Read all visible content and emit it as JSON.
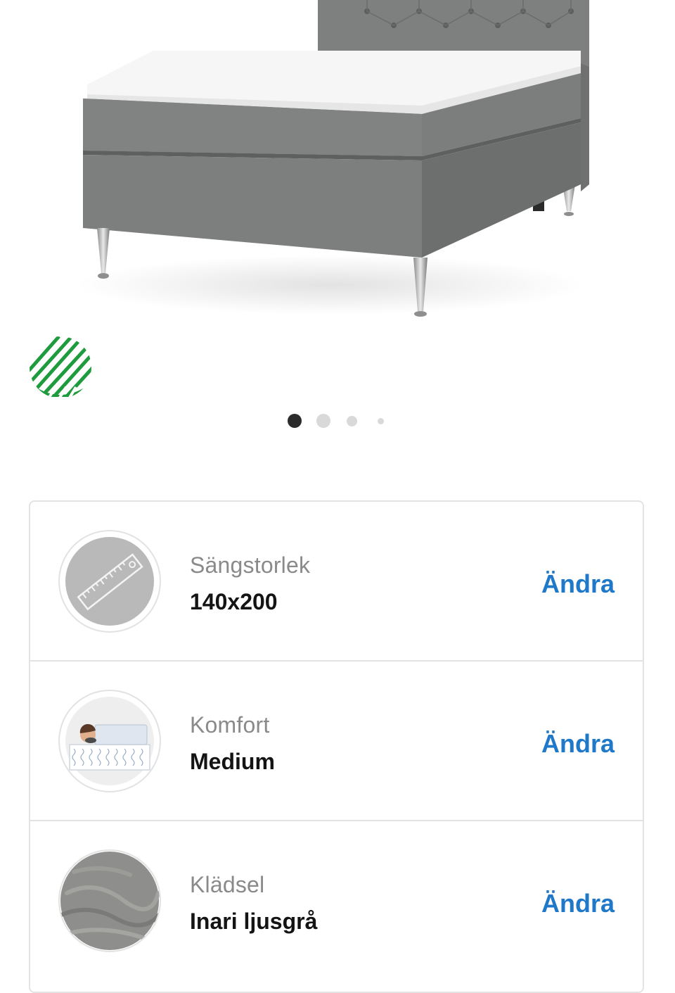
{
  "gallery": {
    "image_alt": "Continental bed in light grey fabric",
    "eco_label_icon": "nordic-swan-ecolabel-icon",
    "slide_count": 4,
    "active_slide": 1
  },
  "configurator": {
    "options": [
      {
        "id": "size",
        "icon": "ruler-icon",
        "label": "Sängstorlek",
        "value": "140x200",
        "action": "Ändra"
      },
      {
        "id": "comfort",
        "icon": "sleeper-on-mattress-icon",
        "label": "Komfort",
        "value": "Medium",
        "action": "Ändra"
      },
      {
        "id": "upholstery",
        "icon": "fabric-swatch-icon",
        "label": "Klädsel",
        "value": "Inari ljusgrå",
        "action": "Ändra"
      }
    ]
  },
  "colors": {
    "accent": "#1f78c8",
    "bed_fabric": "#7b7c7c",
    "eco_green": "#1e9b3c",
    "border": "#e3e3e3"
  }
}
